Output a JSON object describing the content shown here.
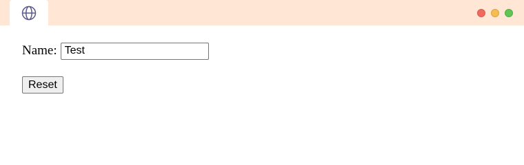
{
  "browser": {
    "tab_icon": "globe-icon",
    "window_controls": [
      {
        "name": "close",
        "color": "#ee6a5f"
      },
      {
        "name": "minimize",
        "color": "#f5bd4f"
      },
      {
        "name": "maximize",
        "color": "#61c454"
      }
    ],
    "titlebar_color": "#ffe6d5"
  },
  "form": {
    "name_label": "Name:",
    "name_value": "Test",
    "reset_label": "Reset"
  }
}
